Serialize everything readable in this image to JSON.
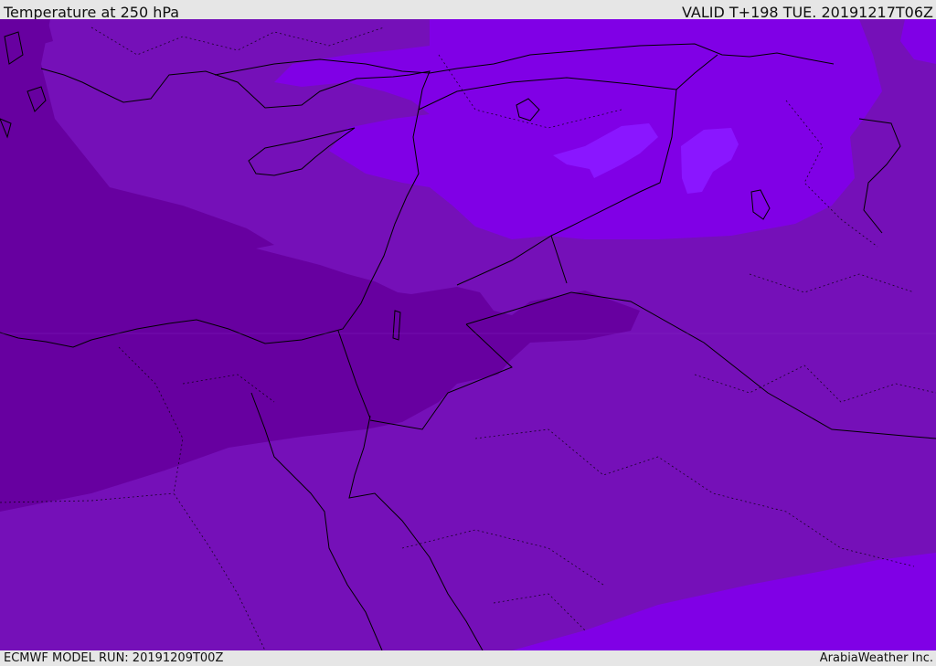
{
  "header": {
    "title": "Temperature at 250 hPa",
    "valid_time": "VALID T+198 TUE. 20191217T06Z"
  },
  "footer": {
    "model_run": "ECMWF MODEL RUN: 20191209T00Z",
    "credit": "ArabiaWeather Inc."
  },
  "map": {
    "fill_colors": {
      "base": "#7510B8",
      "darkest": "#6700A0",
      "bright": "#8000E6",
      "brightest": "#8A16FF"
    },
    "boundary_color": "#000000"
  }
}
